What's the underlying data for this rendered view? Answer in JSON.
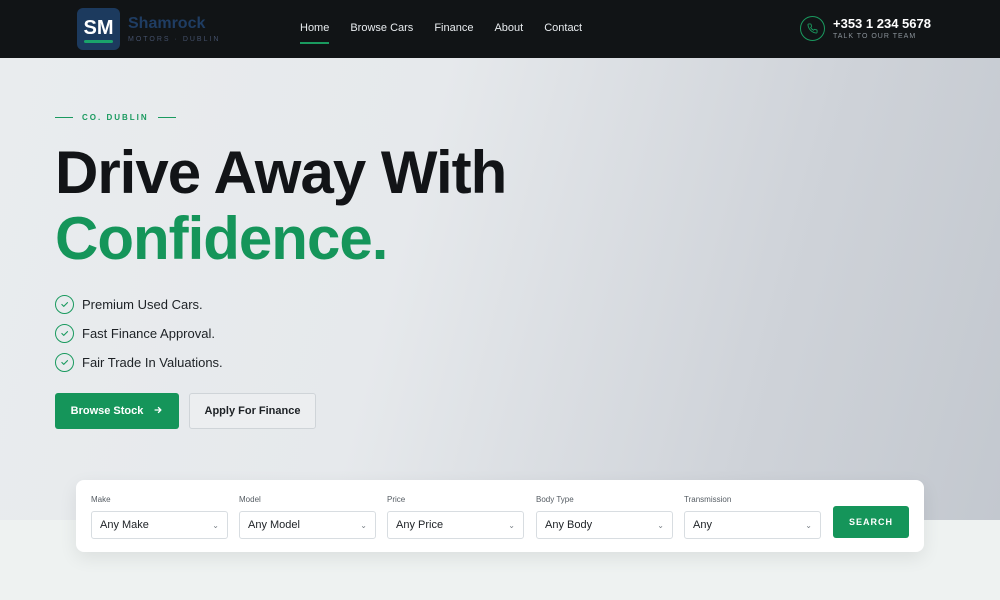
{
  "brand": {
    "initials": "SM",
    "name": "Shamrock",
    "subtitle": "MOTORS · DUBLIN"
  },
  "nav": {
    "items": [
      {
        "label": "Home"
      },
      {
        "label": "Browse Cars"
      },
      {
        "label": "Finance"
      },
      {
        "label": "About"
      },
      {
        "label": "Contact"
      }
    ],
    "active": "Home"
  },
  "contact": {
    "phone": "+353 1 234 5678",
    "subtitle": "TALK TO OUR TEAM",
    "icon": "phone-icon"
  },
  "hero": {
    "eyebrow": "CO. DUBLIN",
    "headline_line1": "Drive Away With",
    "headline_line2": "Confidence.",
    "features": [
      {
        "text": "Premium Used Cars."
      },
      {
        "text": "Fast Finance Approval."
      },
      {
        "text": "Fair Trade In Valuations."
      }
    ],
    "primary_button": "Browse Stock",
    "secondary_button": "Apply For Finance"
  },
  "search": {
    "fields": [
      {
        "label": "Make",
        "value": "Any Make"
      },
      {
        "label": "Model",
        "value": "Any Model"
      },
      {
        "label": "Price",
        "value": "Any Price"
      },
      {
        "label": "Body Type",
        "value": "Any Body"
      },
      {
        "label": "Transmission",
        "value": "Any"
      }
    ],
    "button": "SEARCH"
  },
  "colors": {
    "accent": "#15955a",
    "header_bg": "#111416",
    "brand_badge": "#1c3a5e"
  }
}
